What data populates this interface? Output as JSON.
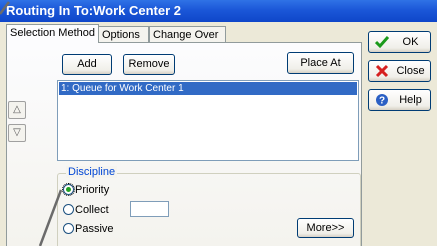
{
  "window": {
    "title": "Routing In To:Work Center 2"
  },
  "tabs": [
    {
      "label": "Selection Method",
      "active": true
    },
    {
      "label": "Options",
      "active": false
    },
    {
      "label": "Change Over",
      "active": false
    }
  ],
  "toolbar": {
    "add_label": "Add",
    "remove_label": "Remove",
    "place_at_label": "Place At"
  },
  "list": {
    "items": [
      "1: Queue for Work Center 1"
    ],
    "selected_index": 0
  },
  "discipline": {
    "legend": "Discipline",
    "options": [
      {
        "label": "Priority",
        "checked": true
      },
      {
        "label": "Collect",
        "checked": false
      },
      {
        "label": "Passive",
        "checked": false
      }
    ],
    "collect_value": "",
    "more_label": "More>>"
  },
  "side_buttons": [
    {
      "label": "OK",
      "icon": "checkmark-icon"
    },
    {
      "label": "Close",
      "icon": "close-x-icon"
    },
    {
      "label": "Help",
      "icon": "help-icon"
    }
  ],
  "colors": {
    "title_bar": "#1b57d8",
    "selection": "#316ac5",
    "legend_text": "#0046d5",
    "ok_check": "#1b9a1b",
    "close_x": "#d62020"
  }
}
